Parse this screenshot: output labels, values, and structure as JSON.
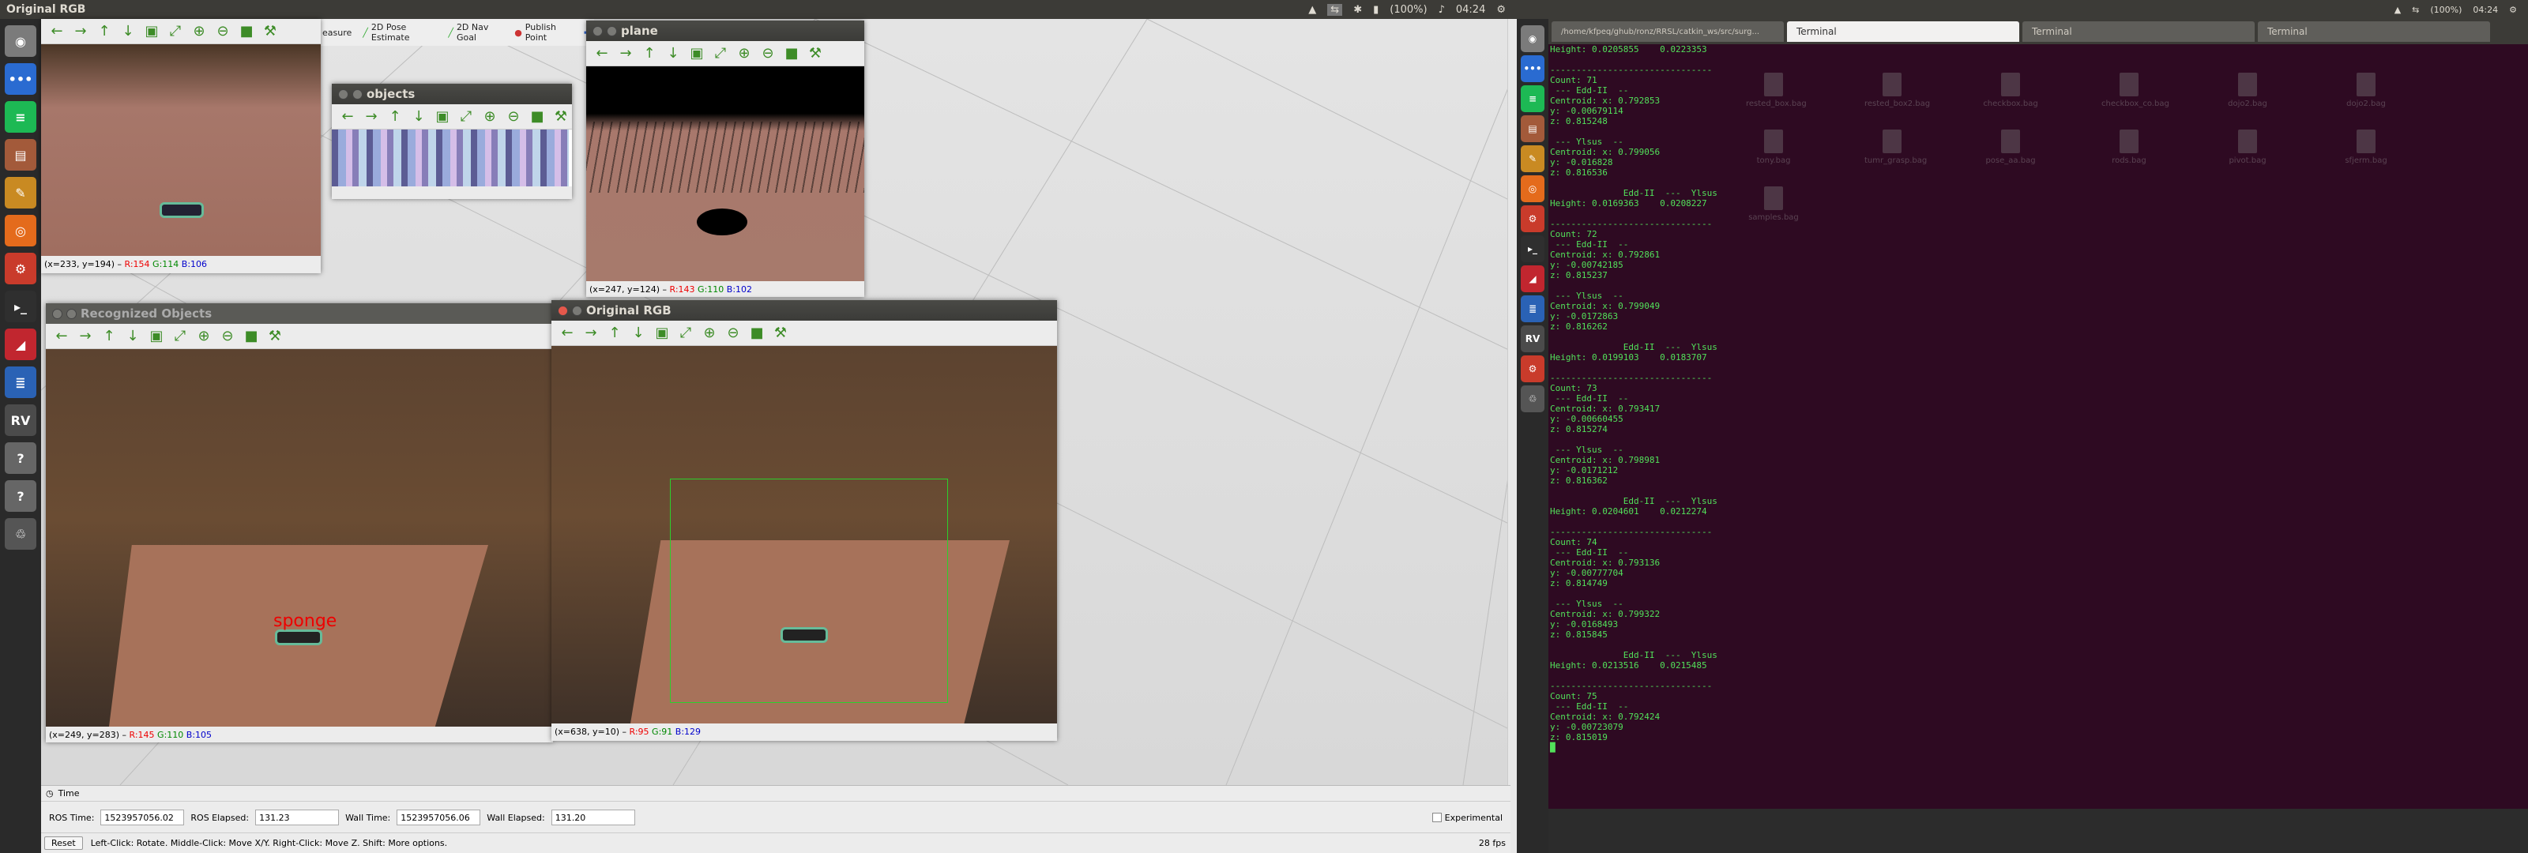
{
  "topbar_left": {
    "title": "Original RGB",
    "time": "04:24",
    "battery": "(100%)"
  },
  "topbar_right": {
    "time": "04:24",
    "battery": "(100%)"
  },
  "launcher_left": [
    "dash-icon",
    "dots-icon",
    "spotify-icon",
    "files-icon",
    "text-editor-icon",
    "firefox-icon",
    "settings-icon",
    "terminal-icon",
    "draw-icon",
    "writer-icon",
    "rviz-icon",
    "help-icon",
    "help-icon",
    "trash-icon"
  ],
  "launcher_right": [
    "dash-icon",
    "dots-icon",
    "spotify-icon",
    "files-icon",
    "text-editor-icon",
    "firefox-icon",
    "settings-icon",
    "terminal-icon",
    "draw-icon",
    "writer-icon",
    "rviz-icon",
    "settings-icon",
    "trash-icon"
  ],
  "rviz_toolbar": {
    "measure": "easure",
    "pose": "2D Pose Estimate",
    "nav": "2D Nav Goal",
    "publish": "Publish Point"
  },
  "windows": {
    "orig_rgb_top": {
      "status_pos": "(x=233, y=194)",
      "r": "R:154",
      "g": "G:114",
      "b": "B:106"
    },
    "objects": {
      "title": "objects"
    },
    "plane": {
      "title": "plane",
      "status_pos": "(x=247, y=124)",
      "r": "R:143",
      "g": "G:110",
      "b": "B:102"
    },
    "recognized": {
      "title": "Recognized Objects",
      "label": "sponge",
      "status_pos": "(x=249, y=283)",
      "r": "R:145",
      "g": "G:110",
      "b": "B:105"
    },
    "orig_rgb": {
      "title": "Original RGB",
      "status_pos": "(x=638, y=10)",
      "r": "R:95",
      "g": "G:91",
      "b": "B:129"
    }
  },
  "terminal": {
    "tabs": [
      "/home/kfpeq/ghub/ronz/RRSL/catkin_ws/src/surg...",
      "Terminal",
      "Terminal",
      "Terminal"
    ],
    "lines": [
      "Height: 0.0205855    0.0223353",
      "",
      "-------------------------------",
      "Count: 71",
      " --- Edd-II  --",
      "Centroid: x: 0.792853",
      "y: -0.00679114",
      "z: 0.815248",
      "",
      " --- Ylsus  --",
      "Centroid: x: 0.799056",
      "y: -0.016828",
      "z: 0.816536",
      "",
      "              Edd-II  ---  Ylsus",
      "Height: 0.0169363    0.0208227",
      "",
      "-------------------------------",
      "Count: 72",
      " --- Edd-II  --",
      "Centroid: x: 0.792861",
      "y: -0.00742185",
      "z: 0.815237",
      "",
      " --- Ylsus  --",
      "Centroid: x: 0.799049",
      "y: -0.0172863",
      "z: 0.816262",
      "",
      "              Edd-II  ---  Ylsus",
      "Height: 0.0199103    0.0183707",
      "",
      "-------------------------------",
      "Count: 73",
      " --- Edd-II  --",
      "Centroid: x: 0.793417",
      "y: -0.00660455",
      "z: 0.815274",
      "",
      " --- Ylsus  --",
      "Centroid: x: 0.798981",
      "y: -0.0171212",
      "z: 0.816362",
      "",
      "              Edd-II  ---  Ylsus",
      "Height: 0.0204601    0.0212274",
      "",
      "-------------------------------",
      "Count: 74",
      " --- Edd-II  --",
      "Centroid: x: 0.793136",
      "y: -0.00777704",
      "z: 0.814749",
      "",
      " --- Ylsus  --",
      "Centroid: x: 0.799322",
      "y: -0.0168493",
      "z: 0.815845",
      "",
      "              Edd-II  ---  Ylsus",
      "Height: 0.0213516    0.0215485",
      "",
      "-------------------------------",
      "Count: 75",
      " --- Edd-II  --",
      "Centroid: x: 0.792424",
      "y: -0.00723079",
      "z: 0.815019",
      "█"
    ],
    "files": [
      "rested_box.bag",
      "rested_box2.bag",
      "checkbox.bag",
      "checkbox_co.bag",
      "dojo2.bag",
      "dojo2.bag",
      "tony.bag",
      "tumr_grasp.bag",
      "pose_aa.bag",
      "rods.bag",
      "pivot.bag",
      "sfjerm.bag",
      "samples.bag"
    ]
  },
  "time_panel": {
    "title": "Time",
    "ros_time_label": "ROS Time:",
    "ros_time": "1523957056.02",
    "ros_elapsed_label": "ROS Elapsed:",
    "ros_elapsed": "131.23",
    "wall_time_label": "Wall Time:",
    "wall_time": "1523957056.06",
    "wall_elapsed_label": "Wall Elapsed:",
    "wall_elapsed": "131.20",
    "experimental": "Experimental"
  },
  "statusbar": {
    "reset": "Reset",
    "help": "Left-Click: Rotate. Middle-Click: Move X/Y. Right-Click: Move Z. Shift: More options.",
    "fps": "28 fps"
  }
}
